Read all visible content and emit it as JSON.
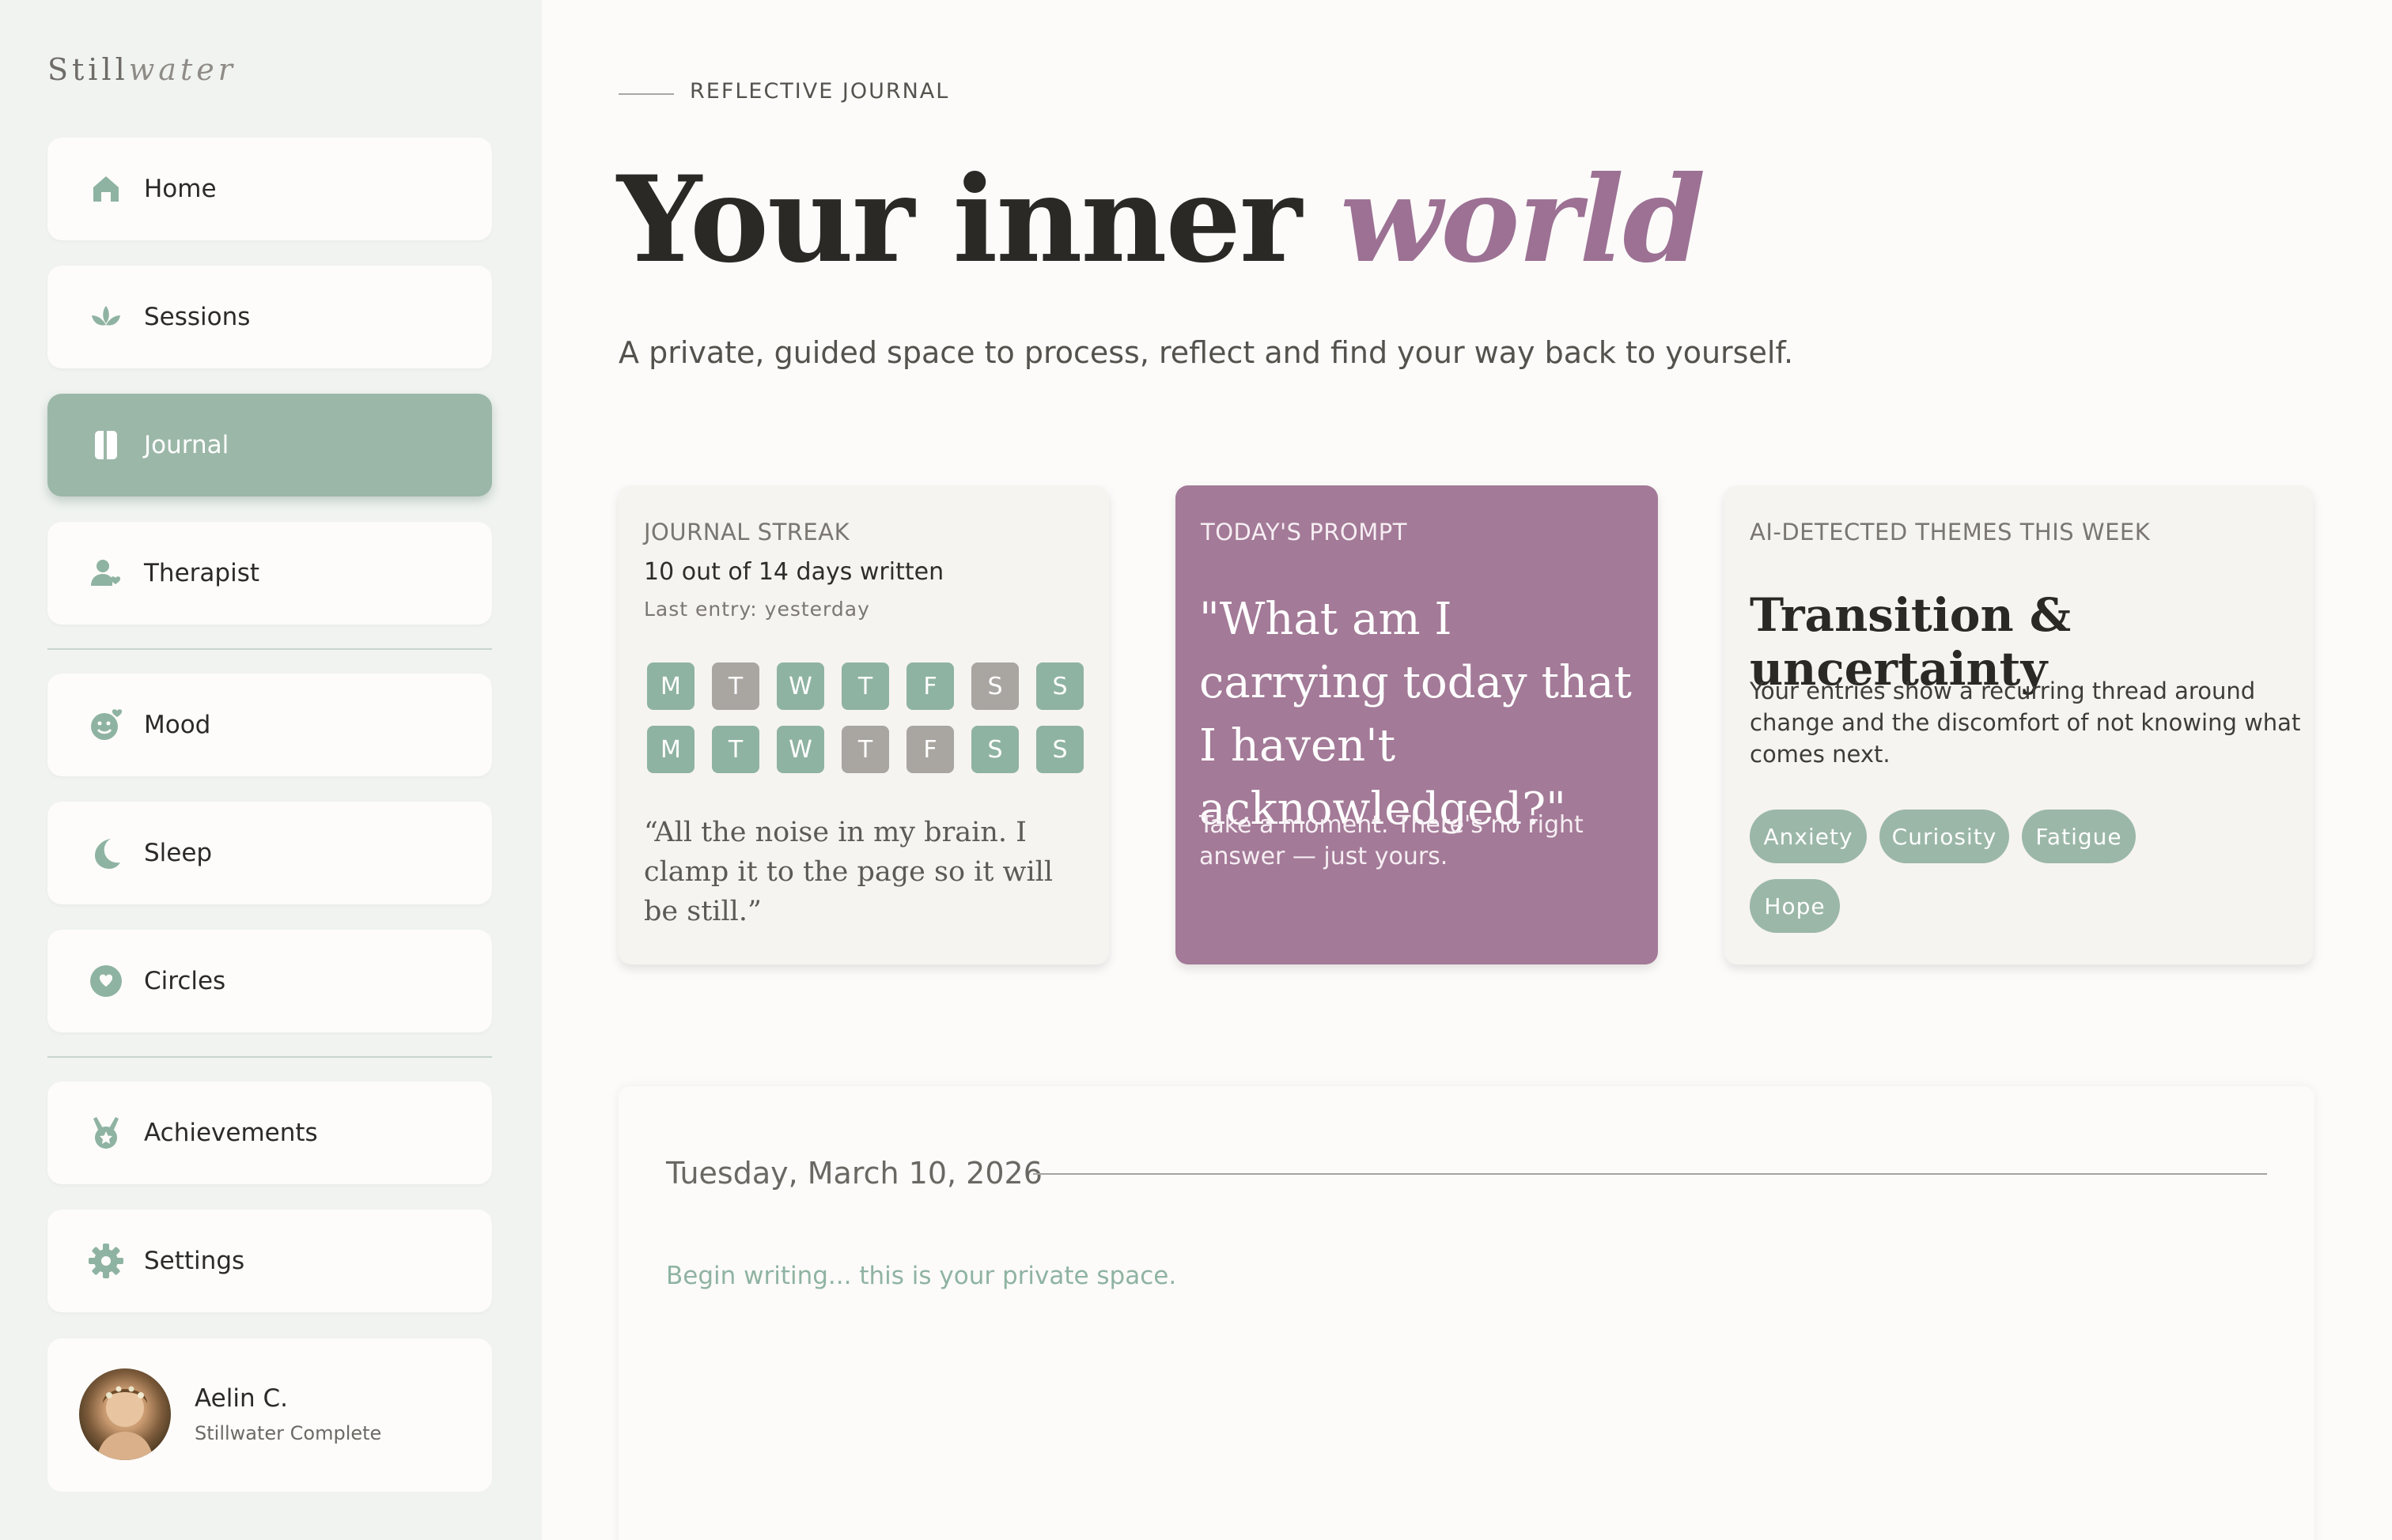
{
  "brand": {
    "plain": "Still",
    "italic": "water"
  },
  "nav": {
    "items": [
      {
        "label": "Home",
        "icon": "home-icon"
      },
      {
        "label": "Sessions",
        "icon": "lotus-icon"
      },
      {
        "label": "Journal",
        "icon": "book-icon",
        "active": true
      },
      {
        "label": "Therapist",
        "icon": "therapist-icon"
      },
      {
        "label": "Mood",
        "icon": "mood-icon"
      },
      {
        "label": "Sleep",
        "icon": "moon-icon"
      },
      {
        "label": "Circles",
        "icon": "heart-circle-icon"
      },
      {
        "label": "Achievements",
        "icon": "medal-icon"
      },
      {
        "label": "Settings",
        "icon": "gear-icon"
      }
    ]
  },
  "profile": {
    "name": "Aelin C.",
    "plan": "Stillwater Complete"
  },
  "header": {
    "eyebrow": "REFLECTIVE JOURNAL",
    "title_plain": "Your inner",
    "title_accent": "world",
    "subtitle": "A private, guided space to process, reflect and find your way back to yourself."
  },
  "streak": {
    "eyebrow": "JOURNAL STREAK",
    "count": "10 out of 14 days written",
    "last": "Last entry: yesterday",
    "weeks": [
      [
        {
          "d": "M",
          "done": true
        },
        {
          "d": "T",
          "done": false
        },
        {
          "d": "W",
          "done": true
        },
        {
          "d": "T",
          "done": true
        },
        {
          "d": "F",
          "done": true
        },
        {
          "d": "S",
          "done": false
        },
        {
          "d": "S",
          "done": true
        }
      ],
      [
        {
          "d": "M",
          "done": true
        },
        {
          "d": "T",
          "done": true
        },
        {
          "d": "W",
          "done": true
        },
        {
          "d": "T",
          "done": false
        },
        {
          "d": "F",
          "done": false
        },
        {
          "d": "S",
          "done": true
        },
        {
          "d": "S",
          "done": true
        }
      ]
    ],
    "quote": "“All the noise in my brain. I clamp it to the page so it will be still.”"
  },
  "prompt": {
    "eyebrow": "TODAY'S PROMPT",
    "text": "\"What am I carrying today that I haven't acknowledged?\"",
    "sub": "Take a moment. There's no right answer — just yours."
  },
  "themes": {
    "eyebrow": "AI-DETECTED THEMES THIS WEEK",
    "title": "Transition & uncertainty",
    "description": "Your entries show a recurring thread around change and the discomfort of not knowing what comes next.",
    "tags": [
      "Anxiety",
      "Curiosity",
      "Fatigue",
      "Hope"
    ]
  },
  "editor": {
    "date": "Tuesday, March 10, 2026",
    "placeholder": "Begin writing... this is your private space."
  },
  "colors": {
    "sage": "#9bb7a8",
    "plum": "#a37a97",
    "accent_text": "#9c7194",
    "missed": "#a9a5a1"
  }
}
